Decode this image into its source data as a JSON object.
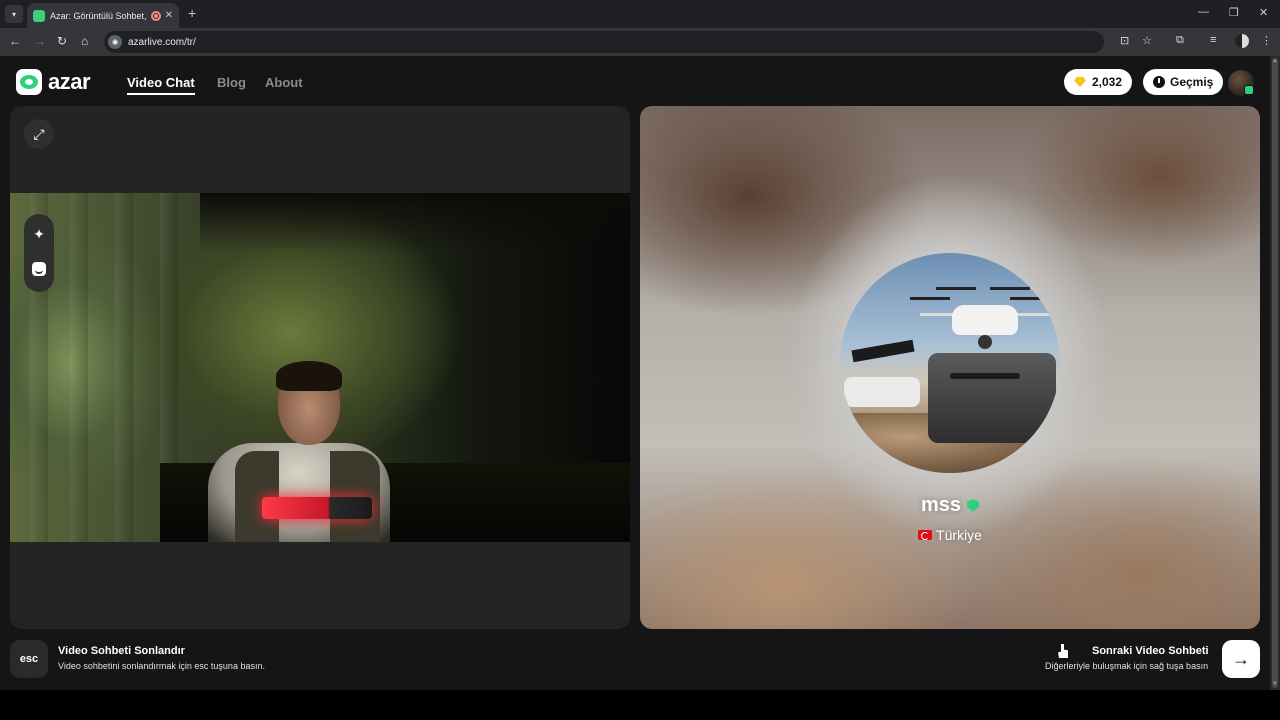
{
  "browser": {
    "tab_title": "Azar: Görüntülü Sohbet, Ye",
    "tab_close": "✕",
    "new_tab": "+",
    "url": "azarlive.com/tr/",
    "window_controls": {
      "minimize": "—",
      "restore": "❐",
      "close": "✕"
    }
  },
  "header": {
    "logo_text": "azar",
    "nav": [
      {
        "label": "Video Chat",
        "active": true
      },
      {
        "label": "Blog",
        "active": false
      },
      {
        "label": "About",
        "active": false
      }
    ],
    "gems": "2,032",
    "history_label": "Geçmiş"
  },
  "left_panel": {
    "expand_icon": "⤢",
    "sparkle_icon": "✦"
  },
  "partner": {
    "username": "mss",
    "country": "Türkiye"
  },
  "footer": {
    "esc_key": "esc",
    "end_title": "Video Sohbeti Sonlandır",
    "end_sub": "Video sohbetini sonlandırmak için esc tuşuna basın.",
    "next_title": "Sonraki Video Sohbeti",
    "next_sub": "Diğerleriyle buluşmak için sağ tuşa basın",
    "next_arrow": "→"
  },
  "colors": {
    "brand_green": "#2ed07b",
    "page_bg": "#151515",
    "gem_yellow": "#f5c518"
  }
}
